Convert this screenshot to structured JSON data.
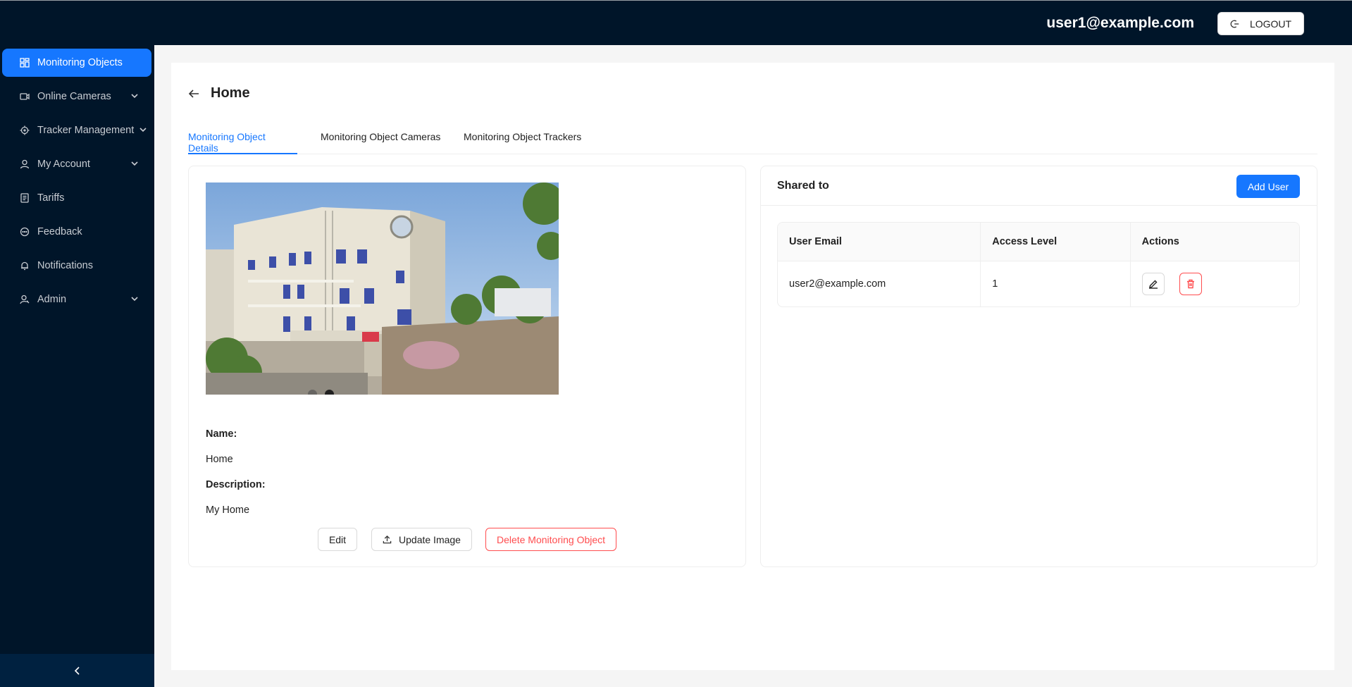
{
  "header": {
    "user_email": "user1@example.com",
    "logout_label": "LOGOUT"
  },
  "sidebar": {
    "items": [
      {
        "label": "Monitoring Objects",
        "icon": "dashboard-icon",
        "active": true
      },
      {
        "label": "Online Cameras",
        "icon": "camera-icon",
        "has_submenu": true
      },
      {
        "label": "Tracker Management",
        "icon": "aim-icon",
        "has_submenu": true
      },
      {
        "label": "My Account",
        "icon": "user-icon",
        "has_submenu": true
      },
      {
        "label": "Tariffs",
        "icon": "receipt-icon"
      },
      {
        "label": "Feedback",
        "icon": "message-icon"
      },
      {
        "label": "Notifications",
        "icon": "bell-icon"
      },
      {
        "label": "Admin",
        "icon": "admin-icon",
        "has_submenu": true
      }
    ],
    "collapse_icon": "chevron-left-icon"
  },
  "page": {
    "title": "Home",
    "tabs": [
      {
        "label": "Monitoring Object Details",
        "active": true
      },
      {
        "label": "Monitoring Object Cameras"
      },
      {
        "label": "Monitoring Object Trackers"
      }
    ]
  },
  "details": {
    "name_label": "Name:",
    "name_value": "Home",
    "description_label": "Description:",
    "description_value": "My Home",
    "carousel_dots": 2,
    "buttons": {
      "edit": "Edit",
      "update_image": "Update Image",
      "delete": "Delete Monitoring Object"
    }
  },
  "shared": {
    "title": "Shared to",
    "add_user_label": "Add User",
    "columns": [
      "User Email",
      "Access Level",
      "Actions"
    ],
    "rows": [
      {
        "email": "user2@example.com",
        "access_level": "1"
      }
    ]
  },
  "colors": {
    "sidebar_bg": "#001529",
    "accent": "#1677ff",
    "danger": "#ff4d4f"
  }
}
